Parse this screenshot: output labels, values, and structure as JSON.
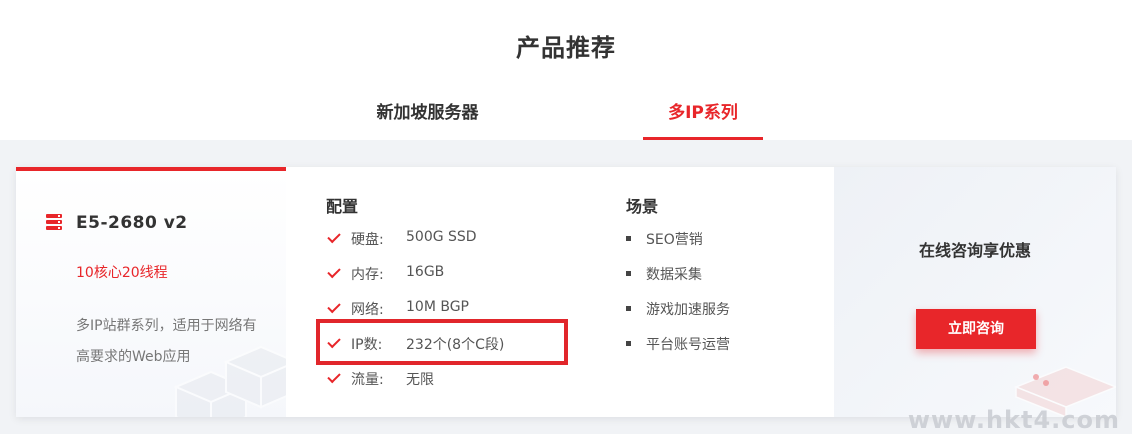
{
  "page": {
    "title": "产品推荐"
  },
  "tabs": [
    {
      "label": "新加坡服务器",
      "active": false
    },
    {
      "label": "多IP系列",
      "active": true
    }
  ],
  "product": {
    "icon": "server-icon",
    "model": "E5-2680 v2",
    "cores": "10核心20线程",
    "description": "多IP站群系列，适用于网络有高要求的Web应用"
  },
  "config": {
    "heading": "配置",
    "rows": [
      {
        "label": "硬盘:",
        "value": "500G SSD"
      },
      {
        "label": "内存:",
        "value": "16GB"
      },
      {
        "label": "网络:",
        "value": "10M BGP"
      },
      {
        "label": "IP数:",
        "value": "232个(8个C段)"
      },
      {
        "label": "流量:",
        "value": "无限"
      }
    ]
  },
  "scenes": {
    "heading": "场景",
    "items": [
      "SEO营销",
      "数据采集",
      "游戏加速服务",
      "平台账号运营"
    ]
  },
  "promo": {
    "text": "在线咨询享优惠",
    "button_label": "立即咨询"
  },
  "watermark": "www.hkt4.com",
  "colors": {
    "accent": "#e8262a",
    "text": "#333333",
    "muted": "#777777",
    "highlight_box": "#e1262b"
  }
}
